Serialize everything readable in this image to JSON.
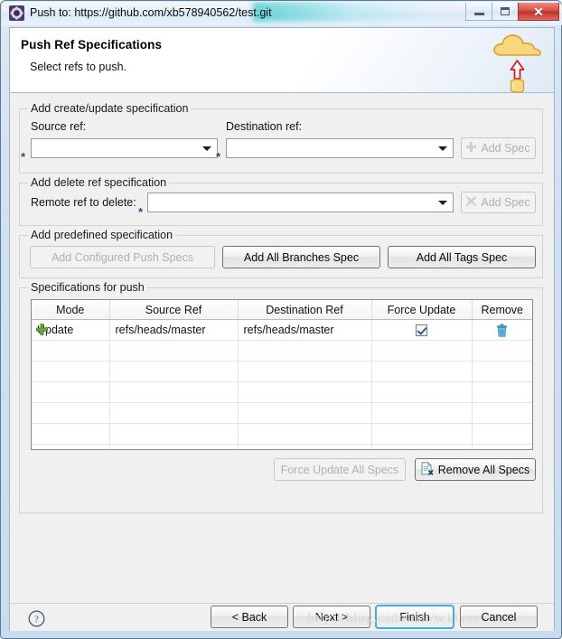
{
  "window": {
    "title": "Push to: https://github.com/xb578940562/test.git",
    "icon": "eclipse-git-icon",
    "buttons": {
      "minimize": "Minimize",
      "maximize": "Maximize",
      "close": "Close"
    },
    "close_color": "#c23127"
  },
  "banner": {
    "title": "Push Ref Specifications",
    "subtitle": "Select refs to push.",
    "icon": "cloud-upload-icon"
  },
  "create_update_group": {
    "title": "Add create/update specification",
    "source_label": "Source ref:",
    "source_value": "",
    "source_placeholder": "",
    "destination_label": "Destination ref:",
    "destination_value": "",
    "destination_placeholder": "",
    "required_marker": "*",
    "add_spec_label": "Add Spec",
    "add_spec_icon": "plus-icon",
    "add_spec_enabled": false
  },
  "delete_group": {
    "title": "Add delete ref specification",
    "remote_label": "Remote ref to delete:",
    "remote_value": "",
    "required_marker": "*",
    "add_spec_label": "Add Spec",
    "add_spec_icon": "cross-icon",
    "add_spec_enabled": false
  },
  "predefined_group": {
    "title": "Add predefined specification",
    "configured_label": "Add Configured Push Specs",
    "configured_enabled": false,
    "all_branches_label": "Add All Branches Spec",
    "all_tags_label": "Add All Tags Spec"
  },
  "specs_group": {
    "title": "Specifications for push",
    "columns": [
      "Mode",
      "Source Ref",
      "Destination Ref",
      "Force Update",
      "Remove"
    ],
    "rows": [
      {
        "mode_icon": "plus-icon",
        "mode": "Update",
        "source_ref": "refs/heads/master",
        "destination_ref": "refs/heads/master",
        "force_update": true,
        "remove_icon": "trash-icon"
      }
    ],
    "empty_row_count": 6,
    "force_update_all_label": "Force Update All Specs",
    "force_update_all_enabled": false,
    "remove_all_label": "Remove All Specs",
    "remove_all_icon": "document-delete-icon"
  },
  "footer": {
    "help_icon": "help-question-icon",
    "back_label": "< Back",
    "next_label": "Next >",
    "finish_label": "Finish",
    "cancel_label": "Cancel",
    "default_button": "Finish",
    "accent_color": "#3faee5"
  },
  "watermark": {
    "text": "http://blog.csdn.net/w11ver"
  }
}
